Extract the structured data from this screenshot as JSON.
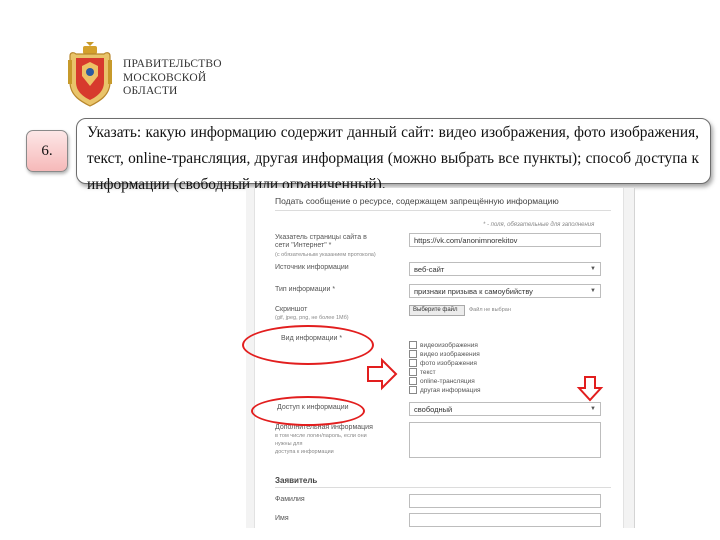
{
  "header": {
    "org_line1": "ПРАВИТЕЛЬСТВО",
    "org_line2": "МОСКОВСКОЙ",
    "org_line3": "ОБЛАСТИ",
    "logo_icon": "moscow-oblast-coat-of-arms-icon"
  },
  "step": {
    "number": "6."
  },
  "instruction": {
    "text": "Указать: какую информацию содержит данный сайт: видео изображения, фото изображения, текст, online-трансляция, другая информация (можно выбрать все пункты); способ доступа к информации (свободный или ограниченный)."
  },
  "form": {
    "title": "Подать сообщение о ресурсе, содержащем запрещённую информацию",
    "required_note": "* - поля, обязательные для заполнения",
    "url_label": "Указатель страницы сайта в сети \"Интернет\" *",
    "url_sublabel": "(с обязательным указанием протокола)",
    "url_value": "https://vk.com/anonimnorekitov",
    "source_label": "Источник информации",
    "source_value": "веб-сайт",
    "type_label": "Тип информации *",
    "type_value": "признаки призыва к самоубийству",
    "screenshot_label": "Скриншот",
    "screenshot_sublabel": "(gif, jpeg, png, не более 1Мб)",
    "choose_file_button": "Выберите файл",
    "no_file_text": "Файл не выбран",
    "kind_label": "Вид информации *",
    "kind_options": [
      "видеоизображения",
      "видео изображения",
      "фото изображения",
      "текст",
      "online-трансляция",
      "другая информация"
    ],
    "access_label": "Доступ к информации",
    "access_value": "свободный",
    "extra_label": "Дополнительная информация",
    "extra_sublabel_1": "в том числе логин/пароль, если они",
    "extra_sublabel_2": "нужны для",
    "extra_sublabel_3": "доступа к информации",
    "applicant_section": "Заявитель",
    "lastname_label": "Фамилия",
    "firstname_label": "Имя"
  },
  "annotations": {
    "ellipse_color": "#e21e1e",
    "arrow_color": "#e21e1e"
  }
}
